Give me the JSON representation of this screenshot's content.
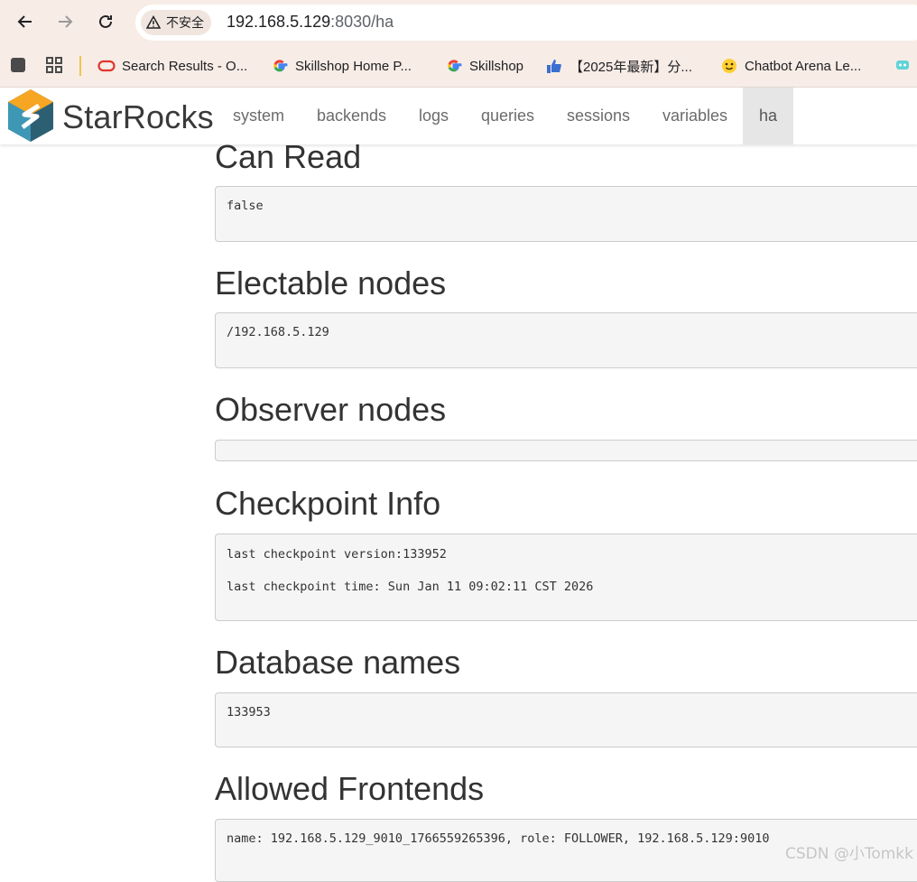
{
  "browser": {
    "security_label": "不安全",
    "url_host": "192.168.5.129",
    "url_rest": ":8030/ha"
  },
  "bookmarks": [
    {
      "label": "Search Results - O...",
      "icon": "oracle-icon"
    },
    {
      "label": "Skillshop Home P...",
      "icon": "google-icon"
    },
    {
      "label": "Skillshop",
      "icon": "google-icon"
    },
    {
      "label": "【2025年最新】分...",
      "icon": "thumbs-up-icon"
    },
    {
      "label": "Chatbot Arena Le...",
      "icon": "hugging-face-icon"
    }
  ],
  "app": {
    "brand": "StarRocks",
    "nav": [
      "system",
      "backends",
      "logs",
      "queries",
      "sessions",
      "variables",
      "ha"
    ],
    "active_nav": "ha"
  },
  "sections": [
    {
      "title": "Can Read",
      "lines": [
        "false"
      ]
    },
    {
      "title": "Electable nodes",
      "lines": [
        "/192.168.5.129"
      ]
    },
    {
      "title": "Observer nodes",
      "lines": []
    },
    {
      "title": "Checkpoint Info",
      "lines": [
        "last checkpoint version:133952",
        "",
        "last checkpoint time: Sun Jan 11 09:02:11 CST 2026"
      ]
    },
    {
      "title": "Database names",
      "lines": [
        "133953"
      ]
    },
    {
      "title": "Allowed Frontends",
      "lines": [
        "name: 192.168.5.129_9010_1766559265396, role: FOLLOWER, 192.168.5.129:9010"
      ]
    }
  ],
  "watermark": "CSDN @小Tomkk"
}
